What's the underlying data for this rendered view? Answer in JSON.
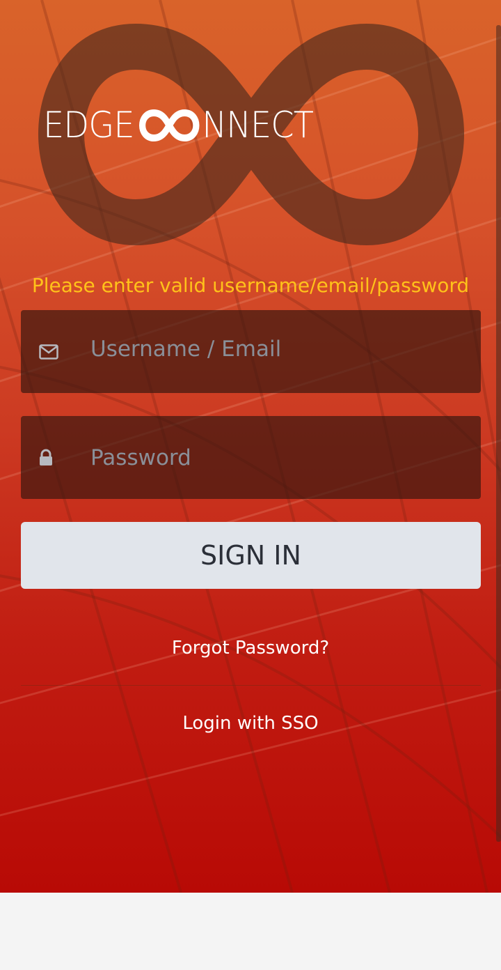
{
  "brand": {
    "logo_text_left": "EDGE",
    "logo_text_right": "NNECT"
  },
  "login": {
    "error_message": "Please enter valid username/email/password",
    "username_placeholder": "Username / Email",
    "password_placeholder": "Password",
    "signin_label": "SIGN IN",
    "forgot_label": "Forgot Password?",
    "sso_label": "Login with SSO"
  },
  "icons": {
    "username": "envelope-icon",
    "password": "lock-icon"
  },
  "colors": {
    "error_text": "#ffc21a",
    "signin_bg": "#e1e5eb",
    "background_top": "#d9632a",
    "background_bottom": "#b80a05"
  }
}
